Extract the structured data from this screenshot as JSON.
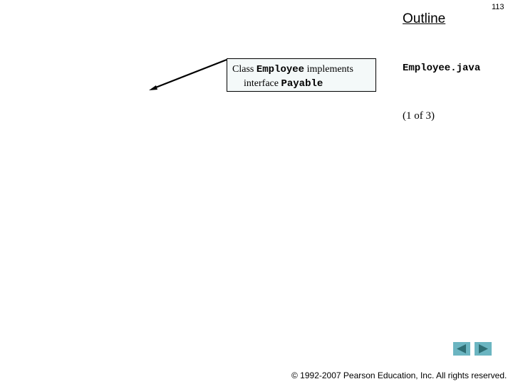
{
  "slide": {
    "page_number": "113",
    "outline_title": "Outline",
    "file_name": "Employee.java",
    "page_indicator": "(1 of  3)"
  },
  "callout": {
    "line1_prefix": "Class ",
    "line1_code": "Employee",
    "line1_suffix": " implements",
    "line2_prefix": "interface ",
    "line2_code": "Payable"
  },
  "navigation": {
    "prev_icon": "triangle-left",
    "next_icon": "triangle-right",
    "button_color": "#6bb5c1",
    "arrow_color": "#2e6e74"
  },
  "footer": {
    "copyright": "© 1992-2007 Pearson Education, Inc.  All rights reserved."
  }
}
